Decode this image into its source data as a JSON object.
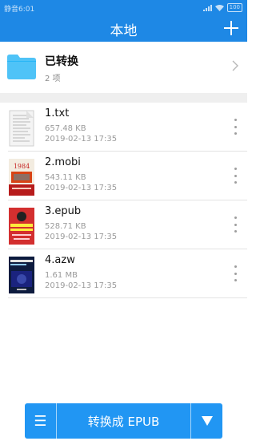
{
  "status_bar": {
    "time": "静音6:01",
    "battery": "100"
  },
  "app_bar": {
    "title": "本地",
    "add_label": "+"
  },
  "converted": {
    "title": "已转换",
    "count": "2 项"
  },
  "files": [
    {
      "name": "1.txt",
      "size": "657.48 KB",
      "date": "2019-02-13 17:35",
      "cover": "txt-document"
    },
    {
      "name": "2.mobi",
      "size": "543.11 KB",
      "date": "2019-02-13 17:35",
      "cover": "book-1984",
      "cover_text": "1984"
    },
    {
      "name": "3.epub",
      "size": "528.71 KB",
      "date": "2019-02-13 17:35",
      "cover": "red-book"
    },
    {
      "name": "4.azw",
      "size": "1.61 MB",
      "date": "2019-02-13 17:35",
      "cover": "dark-blue-book"
    }
  ],
  "bottom_bar": {
    "menu_icon": "☰",
    "convert_label": "转换成 EPUB"
  },
  "colors": {
    "primary": "#1e88e5",
    "button": "#2196f3",
    "folder": "#4fc3f7"
  }
}
